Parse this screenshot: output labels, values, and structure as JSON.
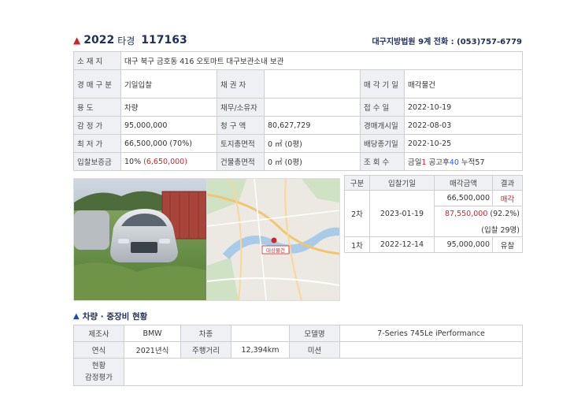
{
  "header": {
    "year": "2022",
    "kind": "타경",
    "number": "117163",
    "court": "대구지방법원 9계 전화 : (053)757-6779"
  },
  "info": {
    "location_label": "소 재 지",
    "location_value": "대구 북구 금호동 416 오토마트 대구보관소내 보관",
    "auction_type_label": "경 매 구 분",
    "auction_type_value": "기일입찰",
    "creditor_label": "채 권 자",
    "creditor_value": "",
    "sale_date_label": "매 각 기 일",
    "sale_date_value": "매각물건",
    "use_label": "용 도",
    "use_value": "차량",
    "debtor_label": "채무/소유자",
    "debtor_value": "",
    "receipt_label": "접 수 일",
    "receipt_value": "2022-10-19",
    "appraisal_label": "감 정 가",
    "appraisal_value": "95,000,000",
    "claim_label": "청 구 액",
    "claim_value": "80,627,729",
    "start_label": "경매개시일",
    "start_value": "2022-08-03",
    "min_label": "최 저 가",
    "min_value": "66,500,000 (70%)",
    "land_label": "토지총면적",
    "land_value": "0 ㎡ (0평)",
    "dividend_label": "배당종기일",
    "dividend_value": "2022-10-25",
    "deposit_label": "입찰보증금",
    "deposit_pct": "10%",
    "deposit_amt": "(6,650,000)",
    "building_label": "건물총면적",
    "building_value": "0 ㎡ (0평)",
    "views_label": "조 회 수",
    "views_today_label": "금일",
    "views_today": "1",
    "views_notice_label": "공고후",
    "views_notice": "40",
    "views_total_label": "누적",
    "views_total": "57"
  },
  "map": {
    "marker_label": "대상물건"
  },
  "bids": {
    "headers": [
      "구분",
      "입찰기일",
      "매각금액",
      "결과"
    ],
    "r2_round": "2차",
    "r2_date": "2023-01-19",
    "r2_min": "66,500,000",
    "r2_result": "매각",
    "r2_sold_amt": "87,550,000",
    "r2_sold_pct": "(92.2%)",
    "r2_bidders": "(입찰 29명)",
    "r1_round": "1차",
    "r1_date": "2022-12-14",
    "r1_amt": "95,000,000",
    "r1_result": "유찰"
  },
  "vehicle": {
    "title": "차량 · 중장비 현황",
    "maker_label": "제조사",
    "maker_value": "BMW",
    "type_label": "차종",
    "type_value": "",
    "model_label": "모델명",
    "model_value": "7-Series 745Le iPerformance",
    "year_label": "연식",
    "year_value": "2021년식",
    "mileage_label": "주행거리",
    "mileage_value": "12,394km",
    "mission_label": "미션",
    "mission_value": "",
    "status_label": "현황",
    "appraisal_eval_label": "감정평가"
  },
  "colors": {
    "accent": "#1f2f5a",
    "red": "#d0232a",
    "blue": "#2a5bd7",
    "label_bg": "#eef0f3"
  }
}
